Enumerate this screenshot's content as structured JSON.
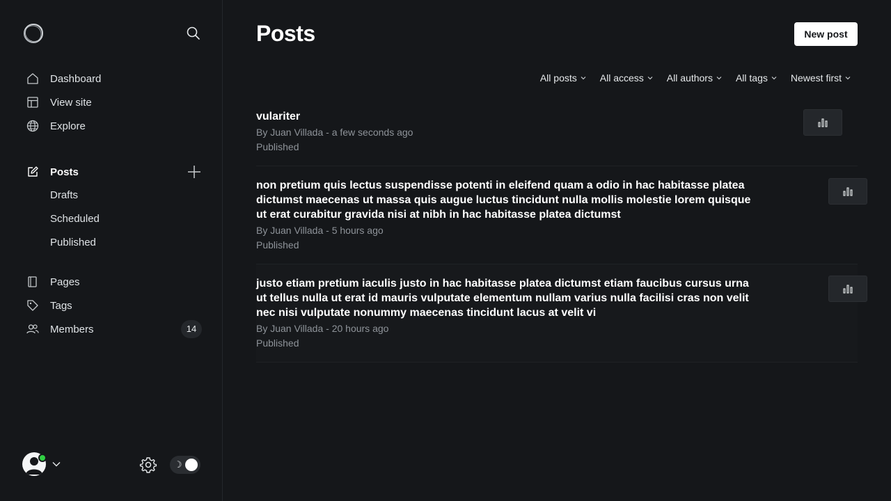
{
  "sidebar": {
    "nav": [
      {
        "label": "Dashboard",
        "icon": "house-icon"
      },
      {
        "label": "View site",
        "icon": "layout-icon"
      },
      {
        "label": "Explore",
        "icon": "globe-icon"
      }
    ],
    "posts": {
      "label": "Posts",
      "icon": "edit-icon",
      "sub": [
        "Drafts",
        "Scheduled",
        "Published"
      ]
    },
    "secondary": [
      {
        "label": "Pages",
        "icon": "pages-icon"
      },
      {
        "label": "Tags",
        "icon": "tag-icon"
      },
      {
        "label": "Members",
        "icon": "members-icon",
        "badge": "14"
      }
    ]
  },
  "header": {
    "title": "Posts",
    "new_post_label": "New post"
  },
  "filters": [
    "All posts",
    "All access",
    "All authors",
    "All tags",
    "Newest first"
  ],
  "posts": [
    {
      "title": "vulariter",
      "meta": "By Juan Villada - a few seconds ago",
      "status": "Published"
    },
    {
      "title": "non pretium quis lectus suspendisse potenti in eleifend quam a odio in hac habitasse platea dictumst maecenas ut massa quis augue luctus tincidunt nulla mollis molestie lorem quisque ut erat curabitur gravida nisi at nibh in hac habitasse platea dictumst",
      "meta": "By Juan Villada - 5 hours ago",
      "status": "Published"
    },
    {
      "title": "justo etiam pretium iaculis justo in hac habitasse platea dictumst etiam faucibus cursus urna ut tellus nulla ut erat id mauris vulputate elementum nullam varius nulla facilisi cras non velit nec nisi vulputate nonummy maecenas tincidunt lacus at velit vi",
      "meta": "By Juan Villada - 20 hours ago",
      "status": "Published"
    }
  ],
  "colors": {
    "background": "#15171a",
    "accent_white": "#ffffff",
    "online_status": "#30cf43",
    "muted_text": "#8e9399"
  }
}
